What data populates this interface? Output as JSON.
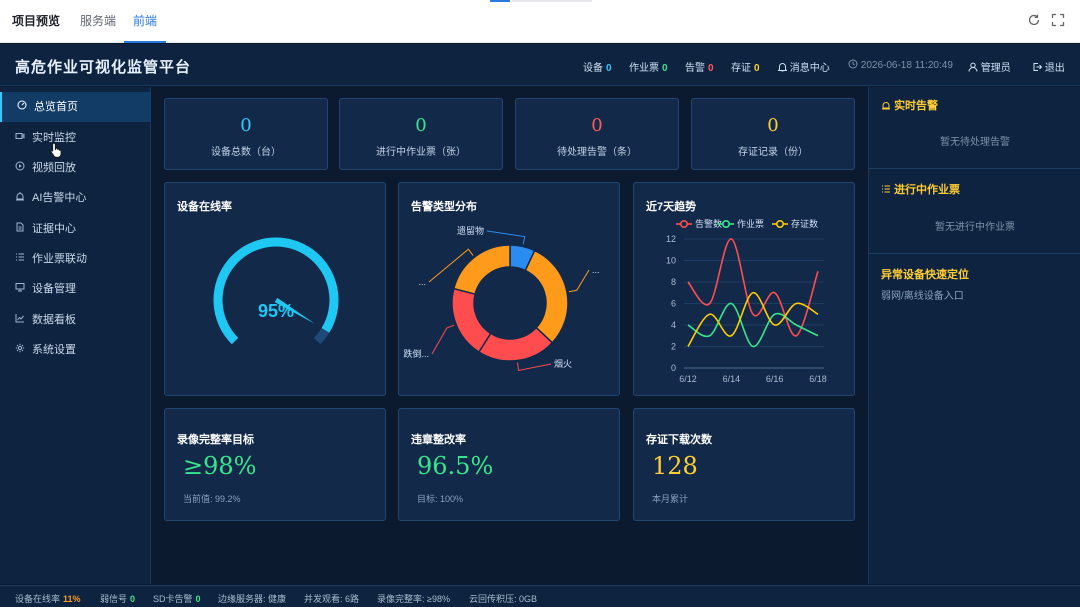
{
  "preview": {
    "title": "项目预览",
    "tabs": [
      "服务端",
      "前端"
    ],
    "active_tab": "前端"
  },
  "header": {
    "title": "高危作业可视化监管平台",
    "device_label": "设备",
    "device_value": "0",
    "ticket_label": "作业票",
    "ticket_value": "0",
    "alarm_label": "告警",
    "alarm_value": "0",
    "evidence_label": "存证",
    "evidence_value": "0",
    "messages": "消息中心",
    "datetime": "2026-06-18 11:20:49",
    "user": "管理员",
    "logout": "退出"
  },
  "sidebar": {
    "items": [
      {
        "label": "总览首页",
        "icon": "dashboard-icon"
      },
      {
        "label": "实时监控",
        "icon": "video-icon"
      },
      {
        "label": "视频回放",
        "icon": "play-icon"
      },
      {
        "label": "AI告警中心",
        "icon": "alarm-icon"
      },
      {
        "label": "证据中心",
        "icon": "document-icon"
      },
      {
        "label": "作业票联动",
        "icon": "list-icon"
      },
      {
        "label": "设备管理",
        "icon": "monitor-icon"
      },
      {
        "label": "数据看板",
        "icon": "chart-icon"
      },
      {
        "label": "系统设置",
        "icon": "gear-icon"
      }
    ],
    "active": "总览首页"
  },
  "stats": [
    {
      "value": "0",
      "label": "设备总数（台）",
      "color": "#35c9ff"
    },
    {
      "value": "0",
      "label": "进行中作业票（张）",
      "color": "#39e58c"
    },
    {
      "value": "0",
      "label": "待处理告警（条）",
      "color": "#ff5a5a"
    },
    {
      "value": "0",
      "label": "存证记录（份）",
      "color": "#ffcc33"
    }
  ],
  "panels": {
    "online_title": "设备在线率",
    "alarm_type_title": "告警类型分布",
    "trend_title": "近7天趋势",
    "video_title": "录像完整率目标",
    "video_value": "≥98%",
    "video_sub": "当前值: 99.2%",
    "rectify_title": "违章整改率",
    "rectify_value": "96.5%",
    "rectify_sub": "目标: 100%",
    "download_title": "存证下载次数",
    "download_value": "128",
    "download_sub": "本月累计"
  },
  "chart_data": [
    {
      "type": "gauge",
      "value": 95,
      "value_label": "95%",
      "range": [
        0,
        100
      ],
      "color": "#1fc8f2"
    },
    {
      "type": "pie",
      "labels": [
        "遗留物",
        "...",
        "烟火",
        "跌倒...",
        "..."
      ],
      "values": [
        7,
        30,
        22,
        20,
        21
      ],
      "colors": [
        "#2a8cf0",
        "#ff9a1a",
        "#ff4d4f",
        "#ff4d4f",
        "#ff9a1a"
      ]
    },
    {
      "type": "line",
      "x": [
        "6/12",
        "6/13",
        "6/14",
        "6/15",
        "6/16",
        "6/17",
        "6/18"
      ],
      "x_ticks": [
        "6/12",
        "6/14",
        "6/16",
        "6/18"
      ],
      "ylim": [
        0,
        12
      ],
      "y_ticks": [
        0,
        2,
        4,
        6,
        8,
        10,
        12
      ],
      "legend_placement": "top",
      "series": [
        {
          "name": "告警数",
          "values": [
            8,
            6,
            12,
            5,
            7,
            3,
            9
          ],
          "color": "#ff4d4f"
        },
        {
          "name": "作业票",
          "values": [
            4,
            3,
            6,
            2,
            5,
            4,
            3
          ],
          "color": "#39e58c"
        },
        {
          "name": "存证数",
          "values": [
            2,
            5,
            3,
            7,
            4,
            6,
            5
          ],
          "color": "#ffcc00"
        }
      ]
    }
  ],
  "right_panel": {
    "realtime_alarm_title": "实时告警",
    "realtime_alarm_empty": "暂无待处理告警",
    "tickets_title": "进行中作业票",
    "tickets_empty": "暂无进行中作业票",
    "locate_title": "异常设备快速定位",
    "locate_link": "弱网/离线设备入口"
  },
  "footer": {
    "online_label": "设备在线率",
    "online_value": "11%",
    "weak_label": "弱信号",
    "weak_value": "0",
    "sd_label": "SD卡告警",
    "sd_value": "0",
    "edge": "边缘服务器: 健康",
    "viewers": "并发观看: 6路",
    "video": "录像完整率: ≥98%",
    "cloud": "云回传积压: 0GB"
  }
}
